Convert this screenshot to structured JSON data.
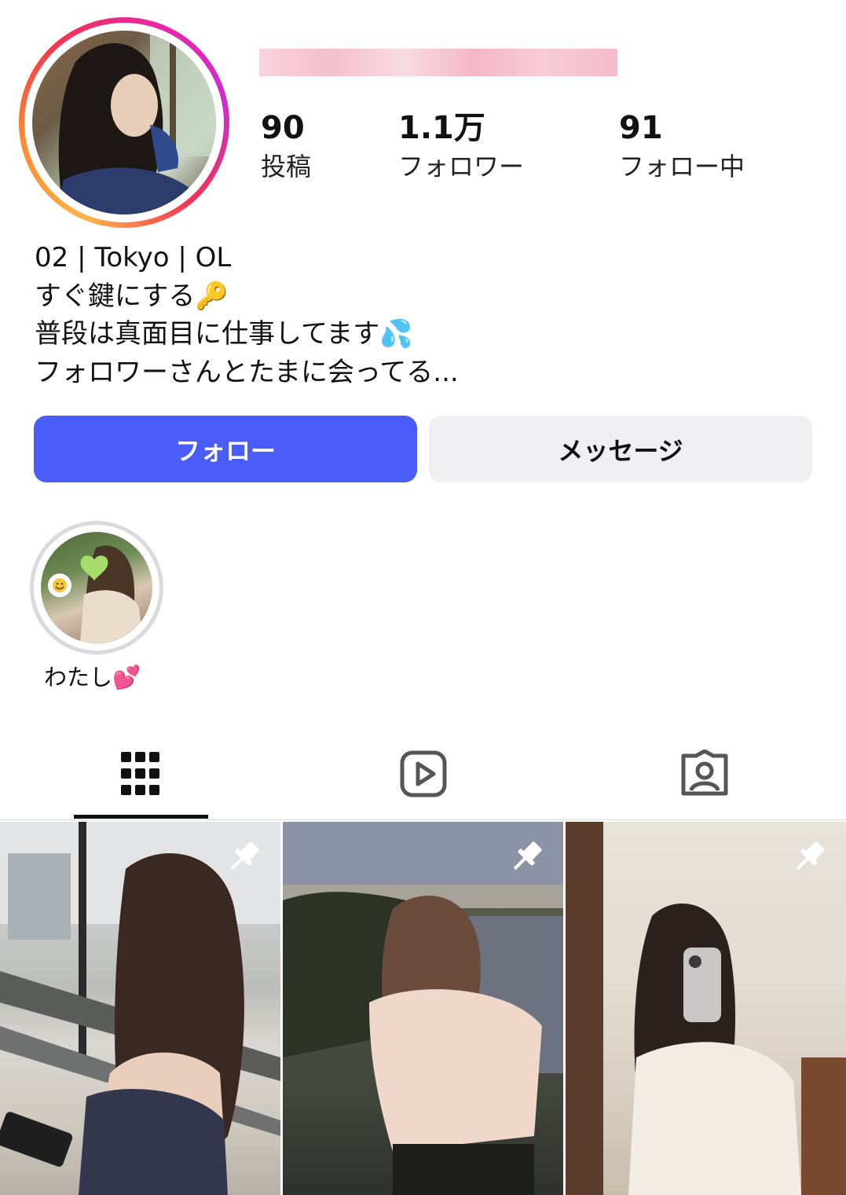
{
  "profile": {
    "stats": {
      "posts": {
        "value": "90",
        "label": "投稿"
      },
      "followers": {
        "value": "1.1万",
        "label": "フォロワー"
      },
      "following": {
        "value": "91",
        "label": "フォロー中"
      }
    },
    "bio": [
      "02 | Tokyo | OL",
      "すぐ鍵にする🔑",
      "普段は真面目に仕事してます💦",
      "フォロワーさんとたまに会ってる..."
    ]
  },
  "actions": {
    "follow_label": "フォロー",
    "message_label": "メッセージ"
  },
  "highlights": [
    {
      "label": "わたし💕"
    }
  ],
  "tabs": [
    {
      "icon": "grid-icon",
      "active": true
    },
    {
      "icon": "reels-icon",
      "active": false
    },
    {
      "icon": "tagged-icon",
      "active": false
    }
  ],
  "posts": [
    {
      "pinned": true
    },
    {
      "pinned": true
    },
    {
      "pinned": true
    }
  ],
  "colors": {
    "follow_button": "#4a5df9",
    "message_button": "#efeff2",
    "story_ring": [
      "#fdb34a",
      "#f5334e",
      "#d02bd0"
    ]
  }
}
